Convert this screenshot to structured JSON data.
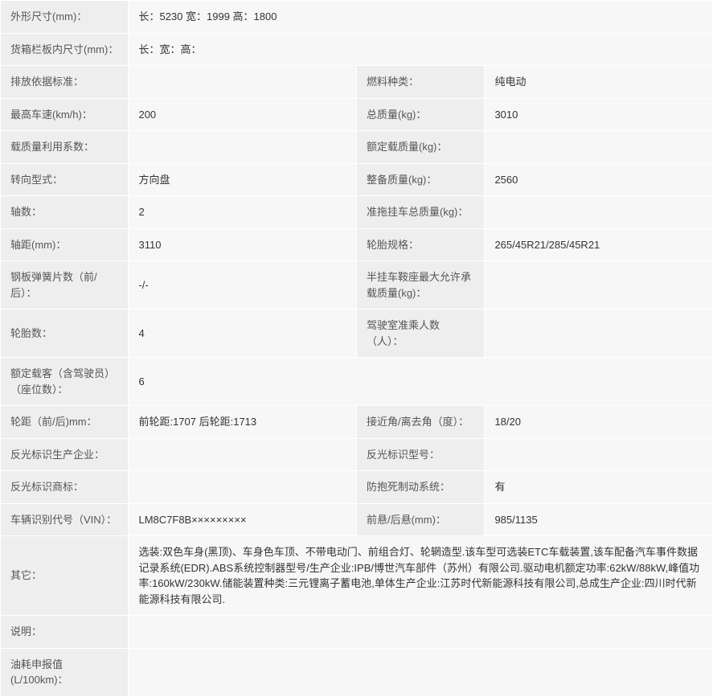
{
  "rows": {
    "dim": {
      "label": "外形尺寸(mm)：",
      "value": "长：5230 宽：1999 高：1800"
    },
    "cargo": {
      "label": "货箱栏板内尺寸(mm)：",
      "value": "长：宽：高："
    },
    "emission": {
      "label": "排放依据标准：",
      "value": ""
    },
    "fuel": {
      "label": "燃料种类：",
      "value": "纯电动"
    },
    "topspeed": {
      "label": "最高车速(km/h)：",
      "value": "200"
    },
    "gross": {
      "label": "总质量(kg)：",
      "value": "3010"
    },
    "loadcoef": {
      "label": "载质量利用系数：",
      "value": ""
    },
    "rated": {
      "label": "额定载质量(kg)：",
      "value": ""
    },
    "steer": {
      "label": "转向型式：",
      "value": "方向盘"
    },
    "curb": {
      "label": "整备质量(kg)：",
      "value": "2560"
    },
    "axles": {
      "label": "轴数：",
      "value": "2"
    },
    "trailer": {
      "label": "准拖挂车总质量(kg)：",
      "value": ""
    },
    "wheelbase": {
      "label": "轴距(mm)：",
      "value": "3110"
    },
    "tire": {
      "label": "轮胎规格：",
      "value": "265/45R21/285/45R21"
    },
    "spring": {
      "label": "钢板弹簧片数（前/后）：",
      "value": "-/-"
    },
    "saddle": {
      "label": "半挂车鞍座最大允许承载质量(kg)：",
      "value": ""
    },
    "tirecount": {
      "label": "轮胎数：",
      "value": "4"
    },
    "cab": {
      "label": "驾驶室准乘人数（人）：",
      "value": ""
    },
    "pax": {
      "label": "额定载客（含驾驶员）（座位数）：",
      "value": "6"
    },
    "track": {
      "label": "轮距（前/后)mm：",
      "value": "前轮距:1707 后轮距:1713"
    },
    "approach": {
      "label": "接近角/离去角（度）：",
      "value": "18/20"
    },
    "reflmfr": {
      "label": "反光标识生产企业：",
      "value": ""
    },
    "reflmodel": {
      "label": "反光标识型号：",
      "value": ""
    },
    "refltm": {
      "label": "反光标识商标：",
      "value": ""
    },
    "abs": {
      "label": "防抱死制动系统：",
      "value": "有"
    },
    "vin": {
      "label": "车辆识别代号（VIN）：",
      "value": "LM8C7F8B×××××××××"
    },
    "overhang": {
      "label": "前悬/后悬(mm)：",
      "value": "985/1135"
    },
    "other": {
      "label": "其它：",
      "value": "选装:双色车身(黑顶)、车身色车顶、不带电动门、前组合灯、轮辋造型.该车型可选装ETC车载装置,该车配备汽车事件数据记录系统(EDR).ABS系统控制器型号/生产企业:IPB/博世汽车部件（苏州）有限公司.驱动电机额定功率:62kW/88kW,峰值功率:160kW/230kW.储能装置种类:三元锂离子蓄电池,单体生产企业:江苏时代新能源科技有限公司,总成生产企业:四川时代新能源科技有限公司."
    },
    "desc": {
      "label": "说明：",
      "value": ""
    },
    "fuelcons": {
      "label": "油耗申报值(L/100km)：",
      "value": ""
    }
  }
}
